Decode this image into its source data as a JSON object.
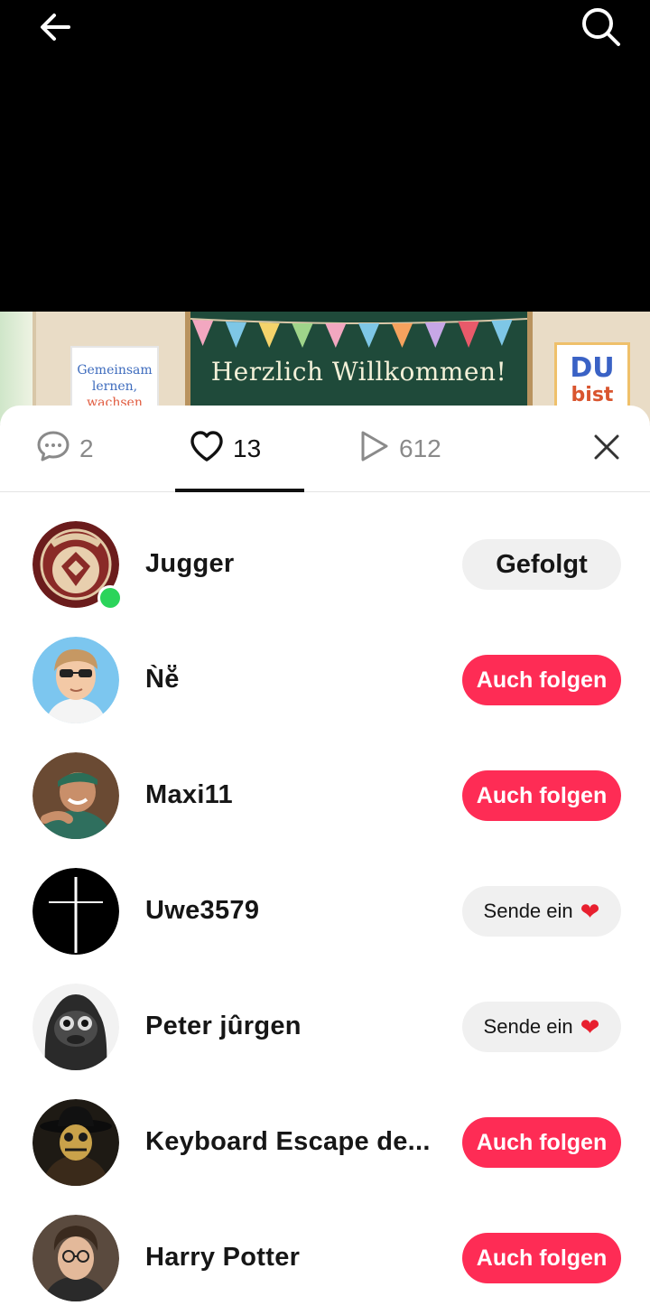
{
  "header": {
    "back_icon": "arrow-left-icon",
    "search_icon": "search-icon"
  },
  "preview": {
    "poster_left": [
      "Gemeinsam",
      "lernen,",
      "wachsen"
    ],
    "board_text": "Herzlich Willkommen!",
    "poster_right": [
      "DU",
      "bist"
    ]
  },
  "tabs": {
    "comments": {
      "icon": "comment-icon",
      "count": "2"
    },
    "likes": {
      "icon": "heart-outline-icon",
      "count": "13"
    },
    "plays": {
      "icon": "play-icon",
      "count": "612"
    }
  },
  "likers": [
    {
      "name": "Jugger",
      "action": "Gefolgt",
      "type": "followed",
      "online": true
    },
    {
      "name": "Ǹě̈",
      "action": "Auch folgen",
      "type": "follow"
    },
    {
      "name": "Maxi11",
      "action": "Auch folgen",
      "type": "follow"
    },
    {
      "name": "Uwe3579",
      "action": "Sende ein",
      "type": "send"
    },
    {
      "name": "Peter jûrgen",
      "action": "Sende ein",
      "type": "send"
    },
    {
      "name": "Keyboard Escape de...",
      "action": "Auch folgen",
      "type": "follow"
    },
    {
      "name": "Harry Potter",
      "action": "Auch folgen",
      "type": "follow"
    }
  ],
  "colors": {
    "accent": "#fe2c55",
    "online": "#2bd45a"
  }
}
